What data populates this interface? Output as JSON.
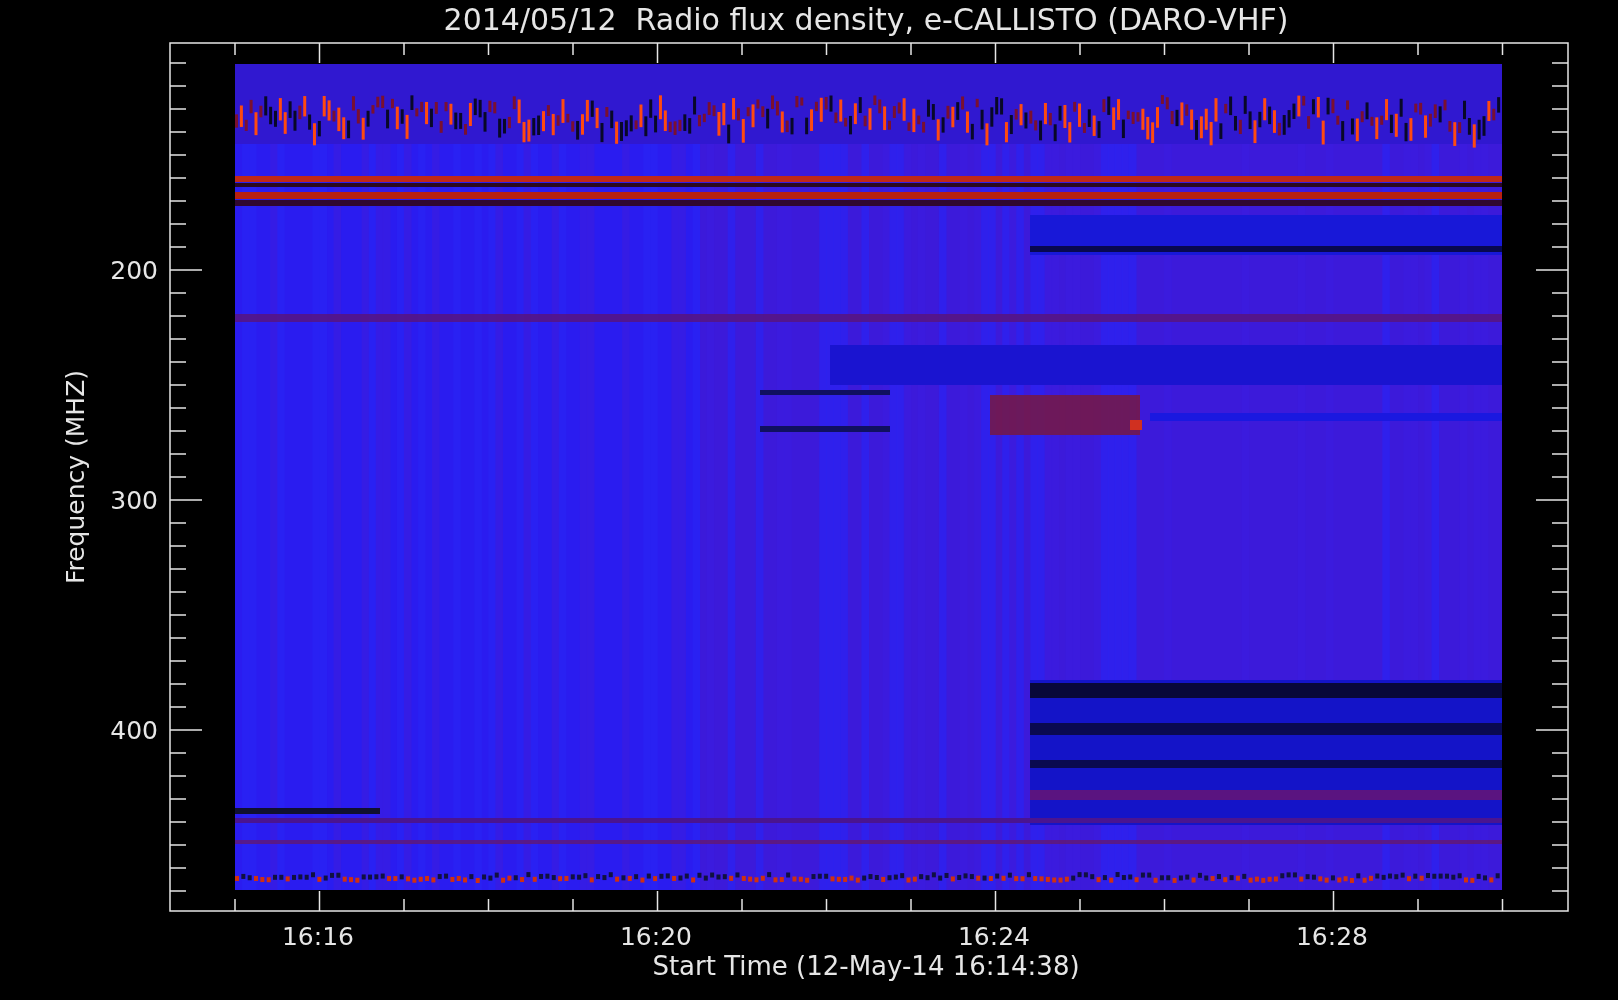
{
  "title": "2014/05/12  Radio flux density, e-CALLISTO (DARO-VHF)",
  "y_axis": {
    "label": "Frequency (MHZ)",
    "ticks": [
      "200",
      "300",
      "400"
    ]
  },
  "x_axis": {
    "label": "Start Time (12-May-14 16:14:38)",
    "ticks": [
      "16:16",
      "16:20",
      "16:24",
      "16:28"
    ]
  }
}
